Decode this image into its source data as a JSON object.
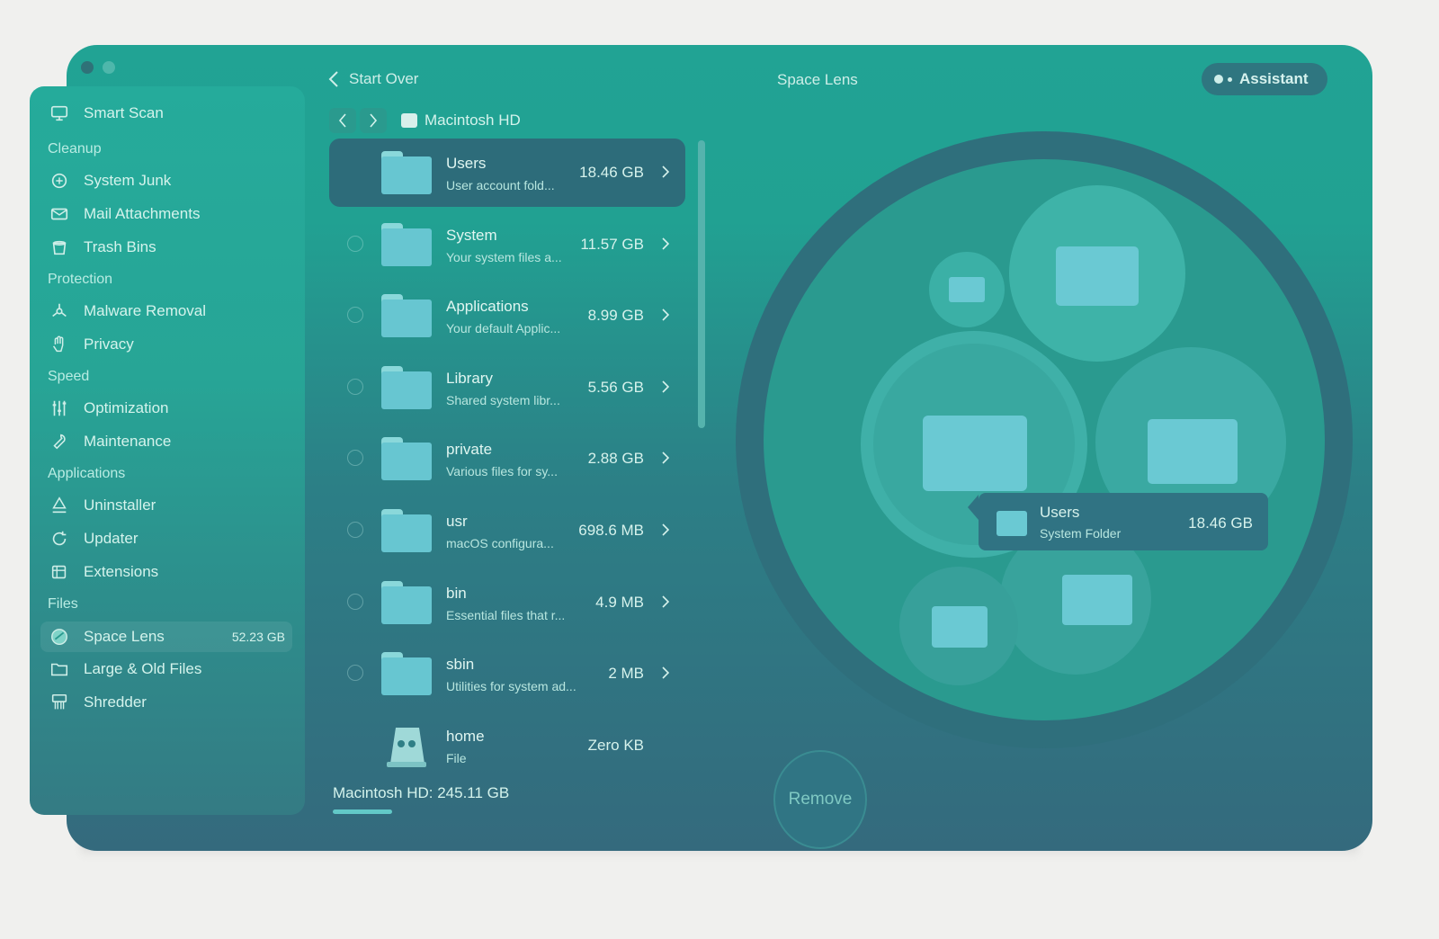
{
  "window": {
    "title": "Space Lens"
  },
  "header": {
    "back_label": "Start Over",
    "assistant_label": "Assistant"
  },
  "breadcrumb": {
    "location": "Macintosh HD"
  },
  "sidebar": {
    "top_item": {
      "label": "Smart Scan",
      "icon": "display-icon"
    },
    "sections": [
      {
        "title": "Cleanup",
        "items": [
          {
            "label": "System Junk",
            "icon": "junk-icon"
          },
          {
            "label": "Mail Attachments",
            "icon": "mail-icon"
          },
          {
            "label": "Trash Bins",
            "icon": "trash-icon"
          }
        ]
      },
      {
        "title": "Protection",
        "items": [
          {
            "label": "Malware Removal",
            "icon": "biohazard-icon"
          },
          {
            "label": "Privacy",
            "icon": "hand-icon"
          }
        ]
      },
      {
        "title": "Speed",
        "items": [
          {
            "label": "Optimization",
            "icon": "sliders-icon"
          },
          {
            "label": "Maintenance",
            "icon": "wrench-icon"
          }
        ]
      },
      {
        "title": "Applications",
        "items": [
          {
            "label": "Uninstaller",
            "icon": "uninstaller-icon"
          },
          {
            "label": "Updater",
            "icon": "update-icon"
          },
          {
            "label": "Extensions",
            "icon": "extensions-icon"
          }
        ]
      },
      {
        "title": "Files",
        "items": [
          {
            "label": "Space Lens",
            "icon": "lens-icon",
            "badge": "52.23 GB",
            "active": true
          },
          {
            "label": "Large & Old Files",
            "icon": "folder-icon"
          },
          {
            "label": "Shredder",
            "icon": "shredder-icon"
          }
        ]
      }
    ]
  },
  "files": [
    {
      "name": "Users",
      "desc": "User account fold...",
      "size": "18.46 GB",
      "selected": true
    },
    {
      "name": "System",
      "desc": "Your system files a...",
      "size": "11.57 GB"
    },
    {
      "name": "Applications",
      "desc": "Your default Applic...",
      "size": "8.99 GB"
    },
    {
      "name": "Library",
      "desc": "Shared system libr...",
      "size": "5.56 GB"
    },
    {
      "name": "private",
      "desc": "Various files for sy...",
      "size": "2.88 GB"
    },
    {
      "name": "usr",
      "desc": "macOS configura...",
      "size": "698.6 MB"
    },
    {
      "name": "bin",
      "desc": "Essential files that r...",
      "size": "4.9 MB"
    },
    {
      "name": "sbin",
      "desc": "Utilities for system ad...",
      "size": "2 MB"
    },
    {
      "name": "home",
      "desc": "File",
      "size": "Zero KB",
      "no_chevron": true
    }
  ],
  "footer": {
    "disk_label": "Macintosh HD: 245.11 GB"
  },
  "tooltip": {
    "name": "Users",
    "desc": "System Folder",
    "size": "18.46 GB"
  },
  "actions": {
    "remove_label": "Remove"
  },
  "colors": {
    "accent": "#21a394",
    "panel_dark": "#346a7d",
    "folder": "#67c6d1"
  }
}
